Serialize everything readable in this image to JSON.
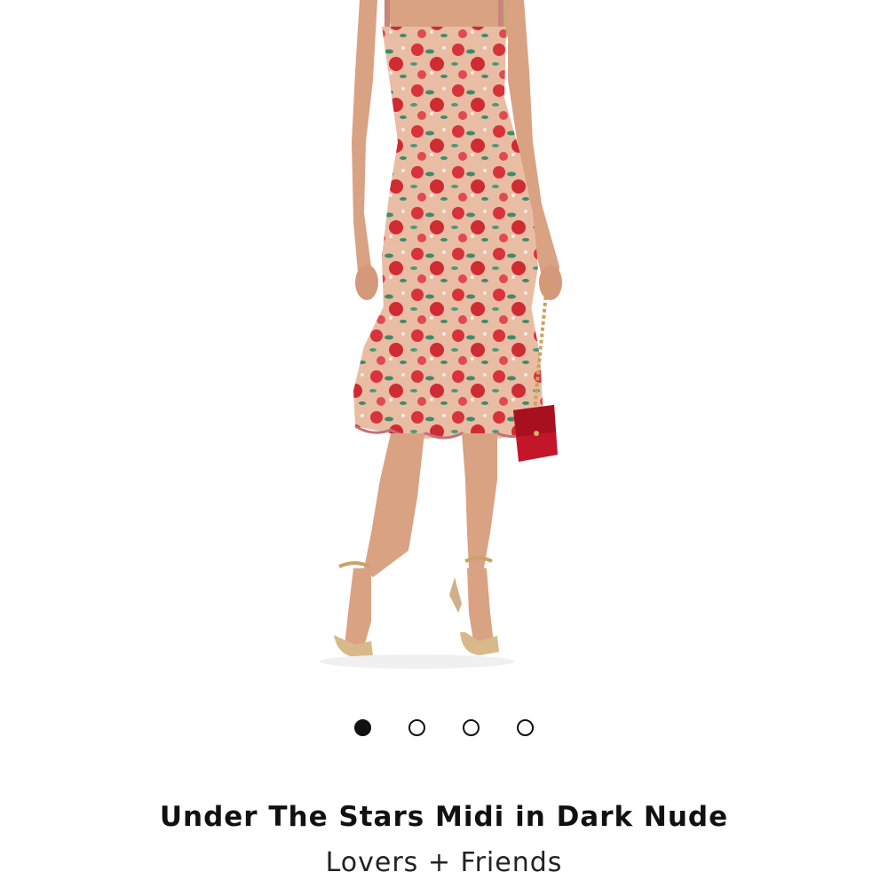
{
  "product": {
    "title": "Under The Stars Midi in Dark Nude",
    "brand": "Lovers + Friends"
  },
  "gallery": {
    "image_count": 4,
    "active_index": 0
  },
  "colors": {
    "dress_base": "#e8b9a0",
    "flower_red": "#d8323a",
    "leaf_green": "#3f8a6a",
    "skin": "#d9a283",
    "bag_red": "#c4162a"
  }
}
